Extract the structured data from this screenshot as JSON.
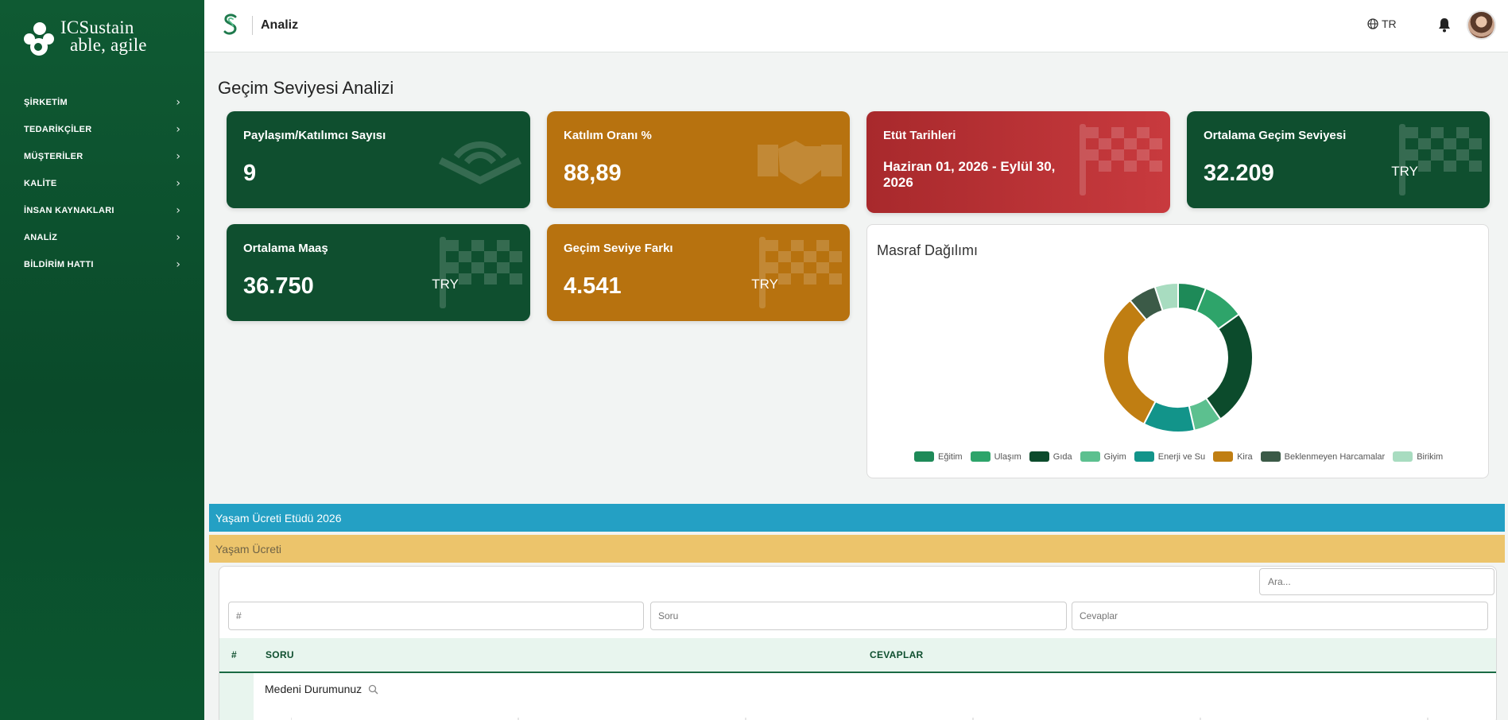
{
  "sidebar": {
    "logo_line1": "ICSustain",
    "logo_line2": "able, agile",
    "items": [
      {
        "label": "ŞİRKETİM"
      },
      {
        "label": "TEDARİKÇİLER"
      },
      {
        "label": "MÜŞTERİLER"
      },
      {
        "label": "KALİTE"
      },
      {
        "label": "İNSAN KAYNAKLARI"
      },
      {
        "label": "ANALİZ"
      },
      {
        "label": "BİLDİRİM HATTI"
      }
    ]
  },
  "header": {
    "breadcrumb": "Analiz",
    "language": "TR"
  },
  "page": {
    "title": "Geçim Seviyesi Analizi"
  },
  "cards": {
    "participants": {
      "title": "Paylaşım/Katılımcı Sayısı",
      "value": "9"
    },
    "participation": {
      "title": "Katılım Oranı %",
      "value": "88,89"
    },
    "study_dates": {
      "title": "Etüt Tarihleri",
      "value": "Haziran 01, 2026 - Eylül 30, 2026"
    },
    "avg_living": {
      "title": "Ortalama Geçim Seviyesi",
      "value": "32.209",
      "unit": "TRY"
    },
    "avg_salary": {
      "title": "Ortalama Maaş",
      "value": "36.750",
      "unit": "TRY"
    },
    "living_gap": {
      "title": "Geçim Seviye Farkı",
      "value": "4.541",
      "unit": "TRY"
    }
  },
  "expense": {
    "title": "Masraf Dağılımı",
    "legend": [
      "Eğitim",
      "Ulaşım",
      "Gıda",
      "Giyim",
      "Enerji ve Su",
      "Kira",
      "Beklenmeyen Harcamalar",
      "Birikim"
    ]
  },
  "chart_data": {
    "type": "pie",
    "donut": true,
    "title": "Masraf Dağılımı",
    "categories": [
      "Eğitim",
      "Ulaşım",
      "Gıda",
      "Giyim",
      "Enerji ve Su",
      "Kira",
      "Beklenmeyen Harcamalar",
      "Birikim"
    ],
    "values": [
      6,
      9,
      25,
      6,
      11,
      31,
      6,
      5
    ],
    "colors": [
      "#1e8a58",
      "#2ea46a",
      "#0c4b2c",
      "#5cc08f",
      "#12948a",
      "#c07e12",
      "#3b5a47",
      "#a8dcc0"
    ],
    "legend_position": "bottom"
  },
  "study": {
    "band_title": "Yaşam Ücreti Etüdü 2026",
    "section_title": "Yaşam Ücreti",
    "search_placeholder": "Ara...",
    "filters": {
      "index_placeholder": "#",
      "question_placeholder": "Soru",
      "answers_placeholder": "Cevaplar"
    },
    "columns": {
      "index": "#",
      "question": "SORU",
      "answers": "CEVAPLAR"
    },
    "rows": [
      {
        "question": "Medeni Durumunuz"
      }
    ]
  }
}
